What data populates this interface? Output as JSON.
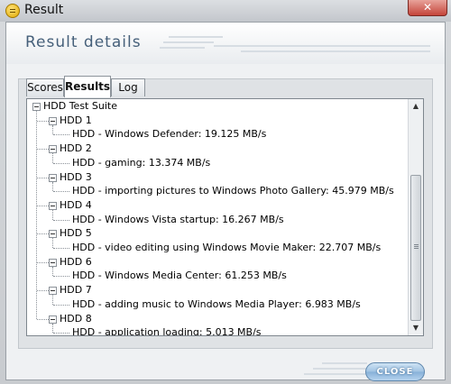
{
  "window": {
    "title": "Result",
    "close_glyph": "✕"
  },
  "header": {
    "title": "Result details"
  },
  "tabs": [
    {
      "label": "Scores",
      "active": false
    },
    {
      "label": "Results",
      "active": true
    },
    {
      "label": "Log",
      "active": false
    }
  ],
  "tree": {
    "root": "HDD Test Suite",
    "items": [
      {
        "group": "HDD 1",
        "detail": "HDD - Windows Defender: 19.125 MB/s"
      },
      {
        "group": "HDD 2",
        "detail": "HDD - gaming: 13.374 MB/s"
      },
      {
        "group": "HDD 3",
        "detail": "HDD - importing pictures to Windows Photo Gallery: 45.979 MB/s"
      },
      {
        "group": "HDD 4",
        "detail": "HDD - Windows Vista startup: 16.267 MB/s"
      },
      {
        "group": "HDD 5",
        "detail": "HDD - video editing using Windows Movie Maker: 22.707 MB/s"
      },
      {
        "group": "HDD 6",
        "detail": "HDD - Windows Media Center: 61.253 MB/s"
      },
      {
        "group": "HDD 7",
        "detail": "HDD - adding music to Windows Media Player: 6.983 MB/s"
      },
      {
        "group": "HDD 8",
        "detail": "HDD - application loading: 5.013 MB/s"
      }
    ]
  },
  "scrollbar": {
    "up_glyph": "▲",
    "down_glyph": "▼"
  },
  "footer": {
    "close_label": "CLOSE"
  },
  "colors": {
    "accent": "#86b0d8",
    "header_text": "#46607a"
  }
}
